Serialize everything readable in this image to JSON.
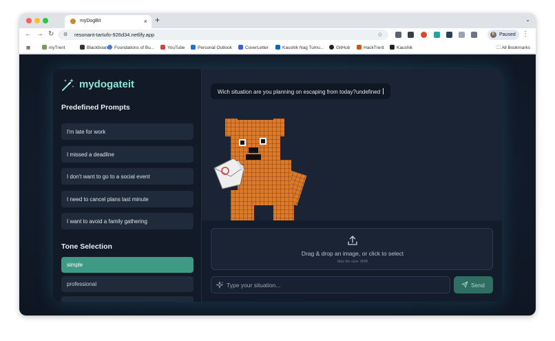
{
  "browser": {
    "tab_title": "myDogBit",
    "url": "resonant-tartufo-926d34.netlify.app",
    "profile_label": "Paused",
    "profile_initial": "K",
    "bookmarks": [
      {
        "label": "myTrent",
        "color": "#7a9a5a"
      },
      {
        "label": "Blackboard",
        "color": "#333333"
      },
      {
        "label": "Foundations of Bu...",
        "color": "#4a7ad8"
      },
      {
        "label": "YouTube",
        "color": "#e53935"
      },
      {
        "label": "Personal Outlook",
        "color": "#1e6fd9"
      },
      {
        "label": "CoverLetter",
        "color": "#3b5fd6"
      },
      {
        "label": "Kaushik Nag Tumu...",
        "color": "#0a66c2"
      },
      {
        "label": "GitHub",
        "color": "#222222"
      },
      {
        "label": "HackTrent",
        "color": "#c4571a"
      },
      {
        "label": "Kaushik",
        "color": "#222222"
      }
    ],
    "all_bookmarks_label": "All Bookmarks"
  },
  "app": {
    "logo_text": "mydogateit",
    "predefined_heading": "Predefined Prompts",
    "prompts": [
      "I'm late for work",
      "I missed a deadline",
      "I don't want to go to a social event",
      "I need to cancel plans last minute",
      "I want to avoid a family gathering"
    ],
    "tone_heading": "Tone Selection",
    "tones": [
      "simple",
      "professional"
    ],
    "selected_tone": "simple",
    "message": "Wich situation are you planning on escaping from today?undefined",
    "dropzone_label": "Drag & drop an image, or click to select",
    "dropzone_hint": "Max file size: 5MB",
    "input_placeholder": "Type your situation...",
    "send_label": "Send",
    "colors": {
      "accent": "#8fe3d1",
      "selected_tone": "#3f9a85",
      "send_button": "#2f6e63"
    }
  }
}
